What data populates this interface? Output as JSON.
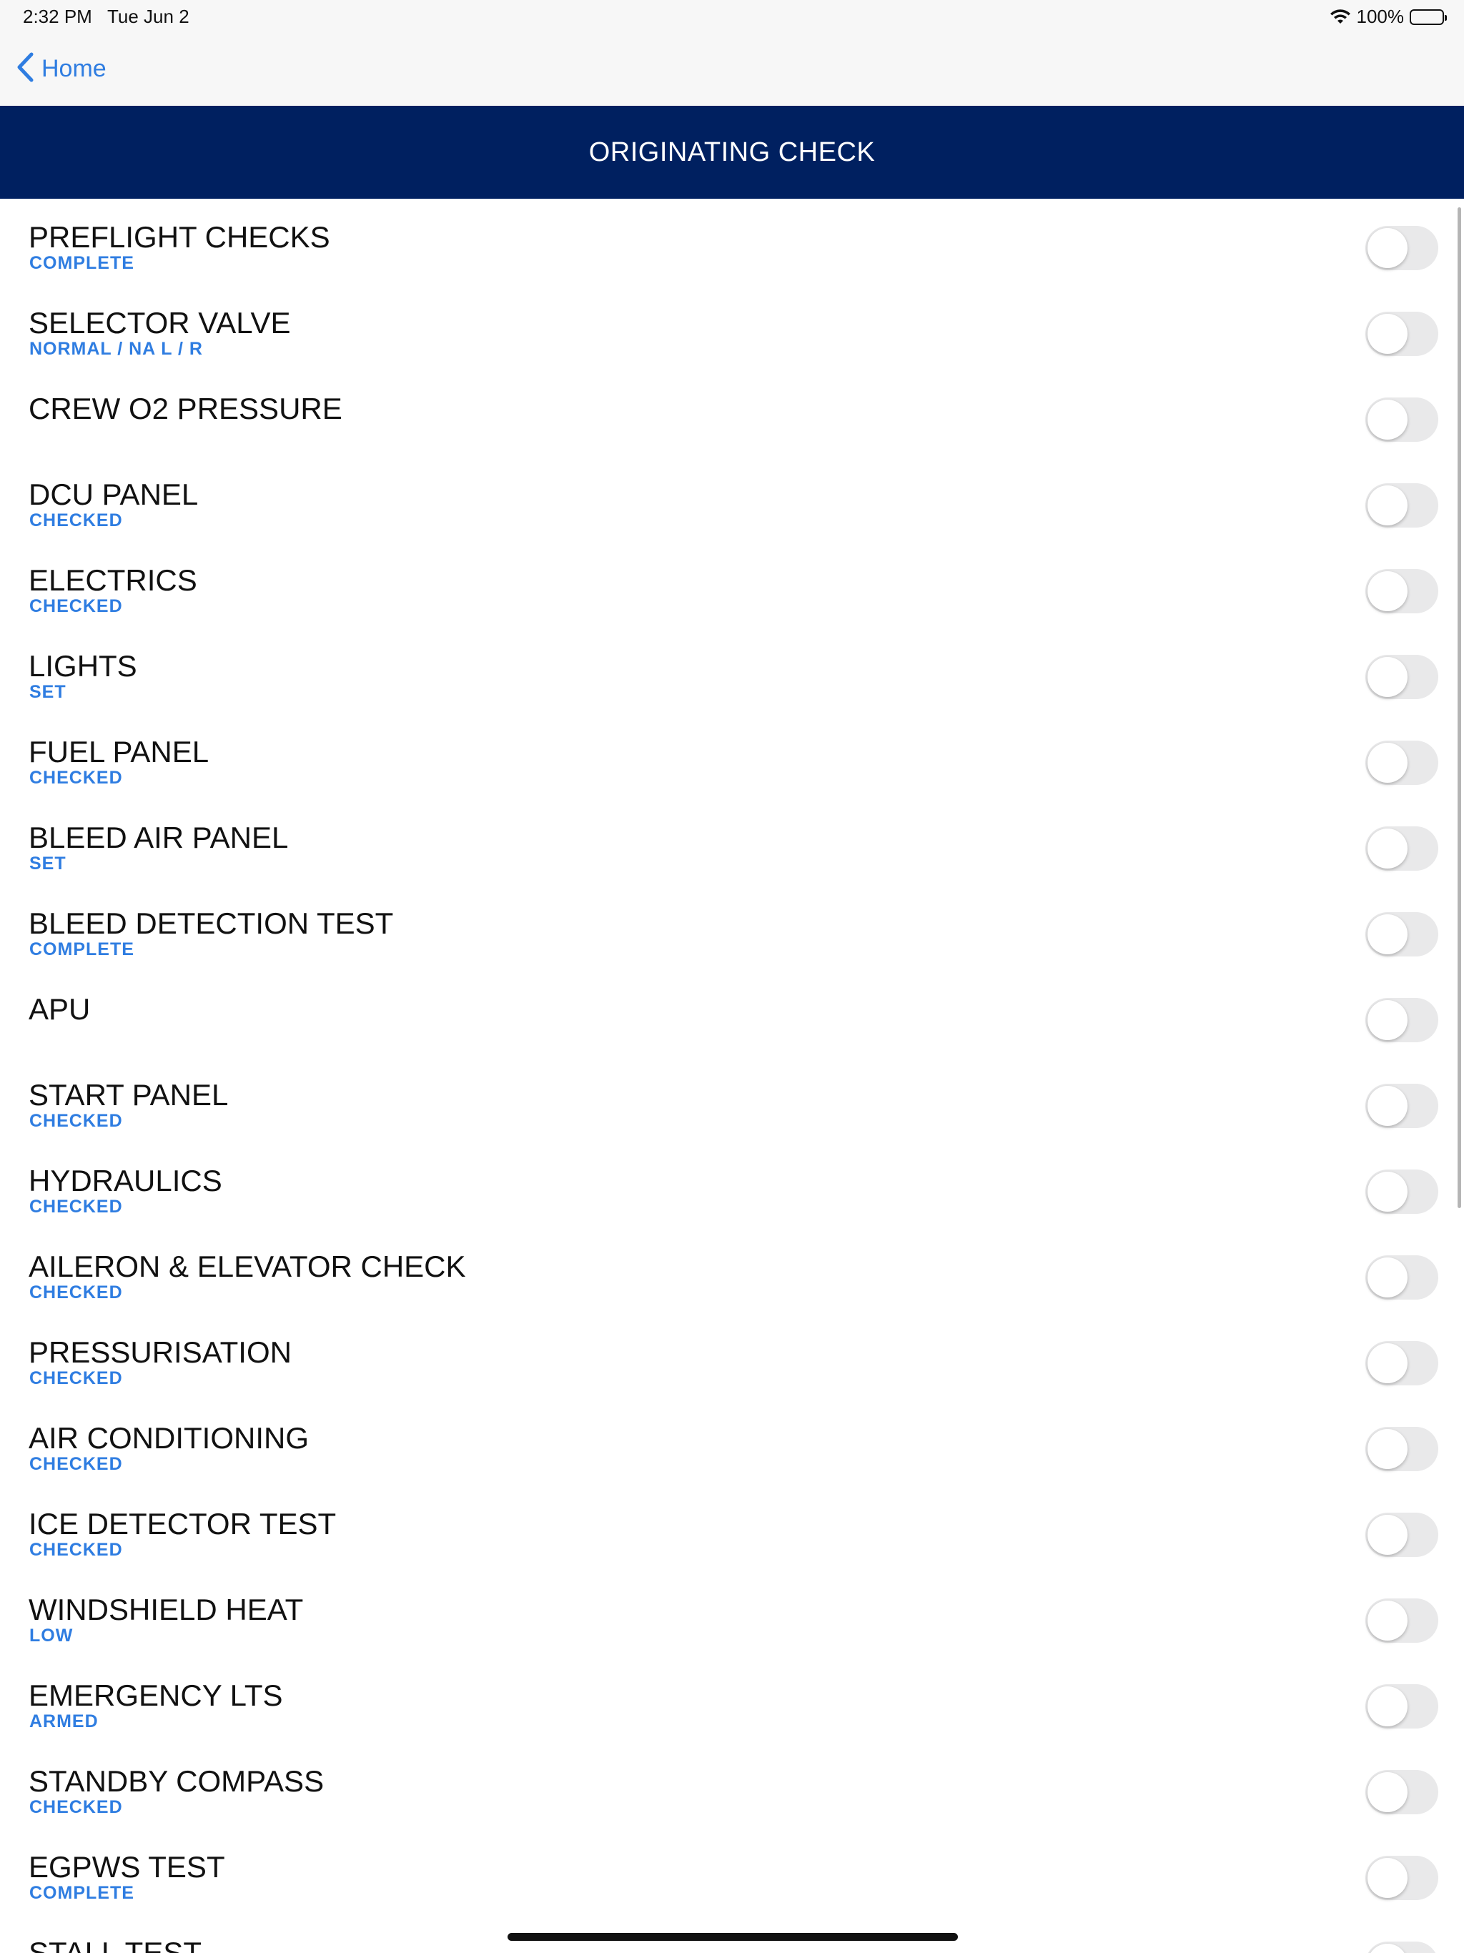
{
  "status_bar": {
    "time": "2:32 PM",
    "date": "Tue Jun 2",
    "battery": "100%",
    "icons": [
      "wifi-icon",
      "battery-icon"
    ]
  },
  "nav": {
    "back_label": "Home",
    "back_icon": "chevron-left-icon"
  },
  "header": {
    "title": "ORIGINATING CHECK"
  },
  "colors": {
    "header_bg": "#002060",
    "accent": "#2f7de1",
    "toggle_off": "#e9e9ea"
  },
  "items": [
    {
      "title": "PREFLIGHT CHECKS",
      "value": "COMPLETE",
      "on": false
    },
    {
      "title": "SELECTOR VALVE",
      "value": "NORMAL / NA L / R",
      "on": false
    },
    {
      "title": "CREW O2 PRESSURE",
      "value": "",
      "on": false
    },
    {
      "title": "DCU PANEL",
      "value": "CHECKED",
      "on": false
    },
    {
      "title": "ELECTRICS",
      "value": "CHECKED",
      "on": false
    },
    {
      "title": "LIGHTS",
      "value": "SET",
      "on": false
    },
    {
      "title": "FUEL PANEL",
      "value": "CHECKED",
      "on": false
    },
    {
      "title": "BLEED AIR PANEL",
      "value": "SET",
      "on": false
    },
    {
      "title": "BLEED DETECTION TEST",
      "value": "COMPLETE",
      "on": false
    },
    {
      "title": "APU",
      "value": "",
      "on": false
    },
    {
      "title": "START PANEL",
      "value": "CHECKED",
      "on": false
    },
    {
      "title": "HYDRAULICS",
      "value": "CHECKED",
      "on": false
    },
    {
      "title": "AILERON & ELEVATOR CHECK",
      "value": "CHECKED",
      "on": false
    },
    {
      "title": "PRESSURISATION",
      "value": "CHECKED",
      "on": false
    },
    {
      "title": "AIR CONDITIONING",
      "value": "CHECKED",
      "on": false
    },
    {
      "title": "ICE DETECTOR TEST",
      "value": "CHECKED",
      "on": false
    },
    {
      "title": "WINDSHIELD HEAT",
      "value": "LOW",
      "on": false
    },
    {
      "title": "EMERGENCY LTS",
      "value": "ARMED",
      "on": false
    },
    {
      "title": "STANDBY COMPASS",
      "value": "CHECKED",
      "on": false
    },
    {
      "title": "EGPWS TEST",
      "value": "COMPLETE",
      "on": false
    },
    {
      "title": "STALL TEST",
      "value": "",
      "on": false
    }
  ]
}
